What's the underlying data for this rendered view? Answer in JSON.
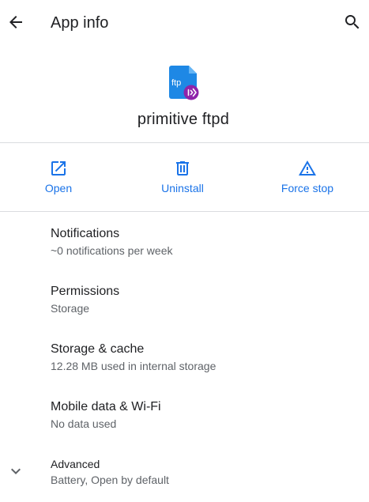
{
  "appbar": {
    "title": "App info",
    "back_icon": "arrow-back-icon",
    "search_icon": "search-icon"
  },
  "app": {
    "name": "primitive ftpd",
    "icon_text": "ftp",
    "icon_color": "#1e88e5",
    "badge_color": "#8e24aa"
  },
  "actions": [
    {
      "label": "Open",
      "icon": "open-in-new-icon"
    },
    {
      "label": "Uninstall",
      "icon": "trash-icon"
    },
    {
      "label": "Force stop",
      "icon": "warning-icon"
    }
  ],
  "settings": [
    {
      "title": "Notifications",
      "subtitle": "~0 notifications per week"
    },
    {
      "title": "Permissions",
      "subtitle": "Storage"
    },
    {
      "title": "Storage & cache",
      "subtitle": "12.28 MB used in internal storage"
    },
    {
      "title": "Mobile data & Wi-Fi",
      "subtitle": "No data used"
    }
  ],
  "advanced": {
    "title": "Advanced",
    "subtitle": "Battery, Open by default",
    "icon": "chevron-down-icon"
  },
  "colors": {
    "accent": "#1a73e8",
    "text_primary": "#202124",
    "text_secondary": "#5f6368",
    "divider": "#dadce0"
  }
}
